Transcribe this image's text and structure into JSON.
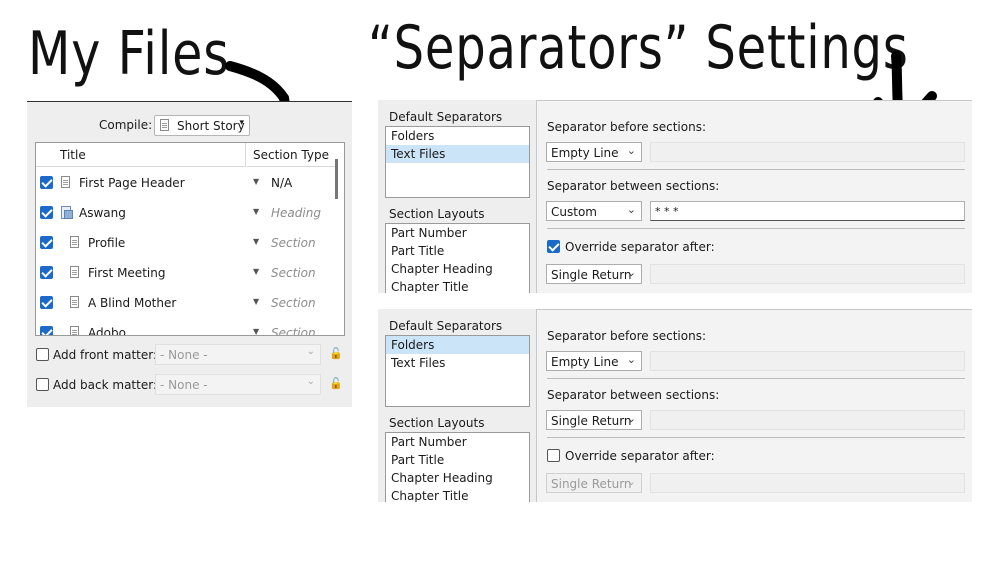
{
  "headings": {
    "left": "My Files",
    "right": "“Separators” Settings"
  },
  "compile": {
    "label": "Compile:",
    "format": "Short Story",
    "caret": "▾"
  },
  "table": {
    "columns": [
      "Title",
      "Section Type"
    ],
    "rows": [
      {
        "title": "First Page Header",
        "type": "N/A",
        "checked": true,
        "icon": "document-icon",
        "indent": 0
      },
      {
        "title": "Aswang",
        "type": "Heading",
        "checked": true,
        "icon": "folder-document-icon",
        "indent": 0
      },
      {
        "title": "Profile",
        "type": "Section",
        "checked": true,
        "icon": "document-icon",
        "indent": 1
      },
      {
        "title": "First Meeting",
        "type": "Section",
        "checked": true,
        "icon": "document-icon",
        "indent": 1
      },
      {
        "title": "A Blind Mother",
        "type": "Section",
        "checked": true,
        "icon": "document-icon",
        "indent": 1
      },
      {
        "title": "Adobo",
        "type": "Section",
        "checked": true,
        "icon": "document-icon",
        "indent": 1
      }
    ]
  },
  "matter": {
    "front": {
      "label": "Add front matter:",
      "value": "- None -"
    },
    "back": {
      "label": "Add back matter:",
      "value": "- None -"
    },
    "chevron": "⌄",
    "lock": "🔓"
  },
  "settings_text_files": {
    "default_separators_label": "Default Separators",
    "default_separators": [
      "Folders",
      "Text Files"
    ],
    "selected": "Text Files",
    "section_layouts_label": "Section Layouts",
    "section_layouts": [
      "Part Number",
      "Part Title",
      "Chapter Heading",
      "Chapter Title"
    ],
    "before_label": "Separator before sections:",
    "before_value": "Empty Line",
    "between_label": "Separator between sections:",
    "between_value": "Custom",
    "between_custom": "* * *",
    "override_label": "Override separator after:",
    "override_checked": true,
    "after_value": "Single Return"
  },
  "settings_folders": {
    "default_separators_label": "Default Separators",
    "default_separators": [
      "Folders",
      "Text Files"
    ],
    "selected": "Folders",
    "section_layouts_label": "Section Layouts",
    "section_layouts": [
      "Part Number",
      "Part Title",
      "Chapter Heading",
      "Chapter Title"
    ],
    "before_label": "Separator before sections:",
    "before_value": "Empty Line",
    "between_label": "Separator between sections:",
    "between_value": "Single Return",
    "override_label": "Override separator after:",
    "override_checked": false,
    "after_value": "Single Return"
  },
  "dropdown_chevron": "⌄",
  "row_triangle": "▼",
  "colors": {
    "accent": "#1b6ac9",
    "selection": "#cce4f7",
    "panel": "#eeeeee"
  }
}
